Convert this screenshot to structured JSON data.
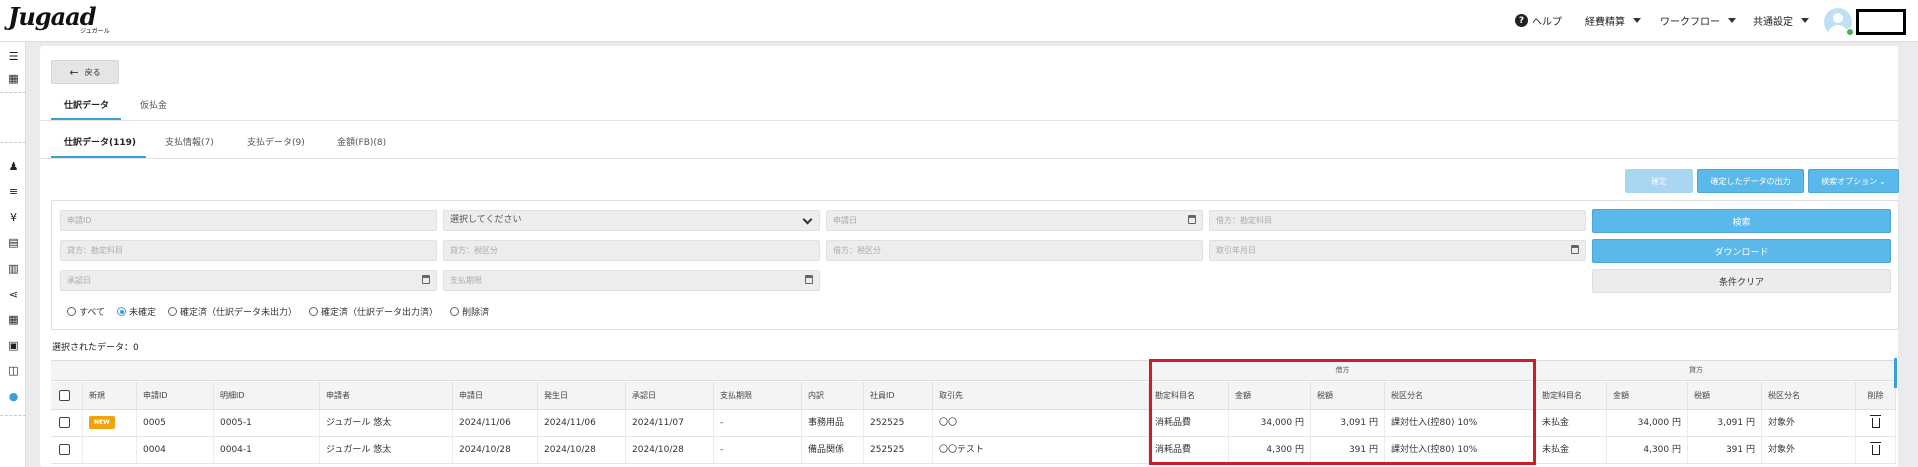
{
  "header": {
    "logo_text": "Jugaad",
    "logo_sub": "ジュガール",
    "help_label": "ヘルプ",
    "menu_expense": "経費精算",
    "menu_workflow": "ワークフロー",
    "menu_settings": "共通設定"
  },
  "page": {
    "back_label": "戻る",
    "main_tabs": [
      "仕訳データ",
      "仮払金"
    ],
    "sub_tabs": [
      "仕訳データ(119)",
      "支払情報(7)",
      "支払データ(9)",
      "金額(FB)(8)"
    ]
  },
  "actions": {
    "confirm": "確定",
    "export_confirmed": "確定したデータの出力",
    "search_options": "検索オプション"
  },
  "filters": {
    "row1": [
      "申請ID",
      "選択してください",
      "申請日",
      "借方：勘定科目"
    ],
    "row2": [
      "貸方：勘定科目",
      "貸方：税区分",
      "借方：税区分",
      "取引年月日"
    ],
    "row3": [
      "承認日",
      "支払期限"
    ],
    "search_btn": "検索",
    "download_btn": "ダウンロード",
    "clear_btn": "条件クリア",
    "radios": [
      "すべて",
      "未確定",
      "確定済（仕訳データ未出力）",
      "確定済（仕訳データ出力済）",
      "削除済"
    ],
    "selected_radio": "未確定"
  },
  "selected_text": "選択されたデータ：0",
  "table": {
    "group_debit": "借方",
    "group_credit": "貸方",
    "columns": [
      "新規",
      "申請ID",
      "明細ID",
      "申請者",
      "申請日",
      "発生日",
      "承認日",
      "支払期限",
      "内訳",
      "社員ID",
      "取引先",
      "勘定科目名",
      "金額",
      "税額",
      "税区分名",
      "勘定科目名",
      "金額",
      "税額",
      "税区分名",
      "削除"
    ],
    "rows": [
      {
        "new_badge": "NEW",
        "cells": [
          "0005",
          "0005-1",
          "ジュガール 悠太",
          "2024/11/06",
          "2024/11/06",
          "2024/11/07",
          "-",
          "事務用品",
          "252525",
          "〇〇",
          "消耗品費",
          "34,000 円",
          "3,091 円",
          "課対仕入(控80) 10%",
          "未払金",
          "34,000 円",
          "3,091 円",
          "対象外"
        ]
      },
      {
        "new_badge": "",
        "cells": [
          "0004",
          "0004-1",
          "ジュガール 悠太",
          "2024/10/28",
          "2024/10/28",
          "2024/10/28",
          "-",
          "備品関係",
          "252525",
          "〇〇テスト",
          "消耗品費",
          "4,300 円",
          "391 円",
          "課対仕入(控80) 10%",
          "未払金",
          "4,300 円",
          "391 円",
          "対象外"
        ]
      }
    ]
  },
  "colors": {
    "accent": "#3aa0d8",
    "button_blue": "#5bb8ea",
    "highlight_red": "#d01c28",
    "new_badge": "#f0a30a"
  }
}
